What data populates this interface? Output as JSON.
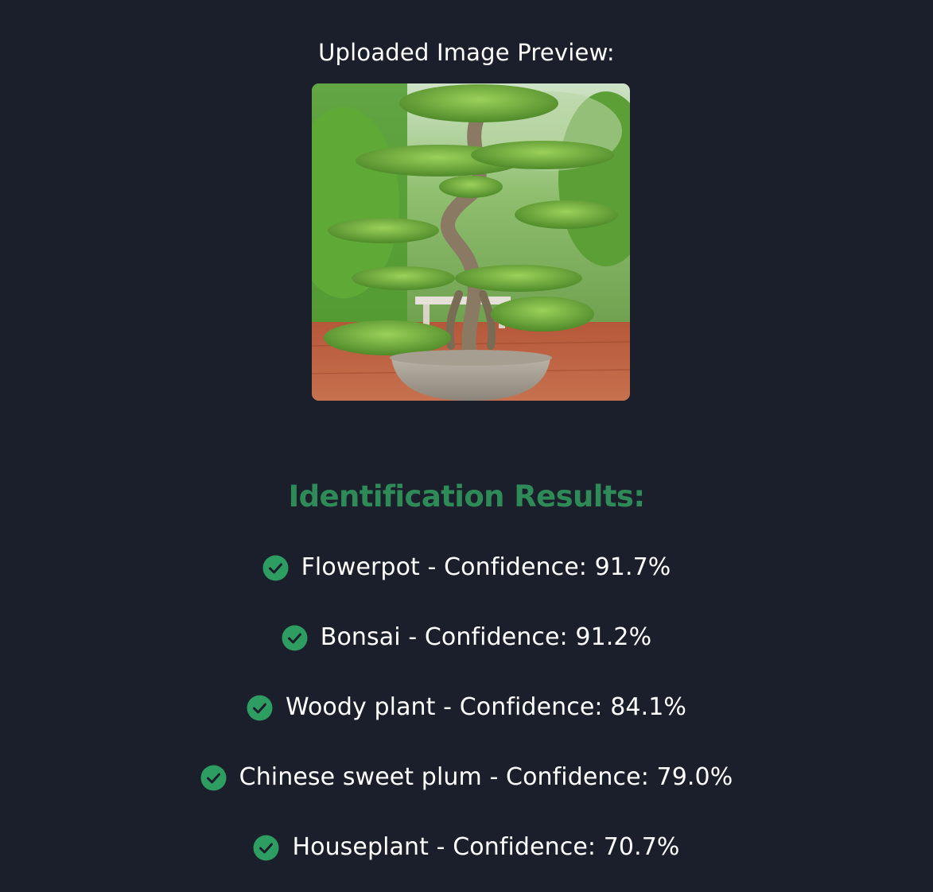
{
  "preview": {
    "label": "Uploaded Image Preview:",
    "image_subject": "bonsai tree in a stone bowl pot"
  },
  "results": {
    "heading": "Identification Results:",
    "heading_color": "#2e8b57",
    "check_color": "#2e9d62",
    "items": [
      {
        "name": "Flowerpot",
        "confidence": "91.7%",
        "text": "Flowerpot - Confidence: 91.7%",
        "icon": "check-circle-icon"
      },
      {
        "name": "Bonsai",
        "confidence": "91.2%",
        "text": "Bonsai - Confidence: 91.2%",
        "icon": "check-circle-icon"
      },
      {
        "name": "Woody plant",
        "confidence": "84.1%",
        "text": "Woody plant - Confidence: 84.1%",
        "icon": "check-circle-icon"
      },
      {
        "name": "Chinese sweet plum",
        "confidence": "79.0%",
        "text": "Chinese sweet plum - Confidence: 79.0%",
        "icon": "check-circle-icon"
      },
      {
        "name": "Houseplant",
        "confidence": "70.7%",
        "text": "Houseplant - Confidence: 70.7%",
        "icon": "check-circle-icon"
      }
    ]
  },
  "colors": {
    "background": "#1b1f2b",
    "text": "#ffffff"
  }
}
